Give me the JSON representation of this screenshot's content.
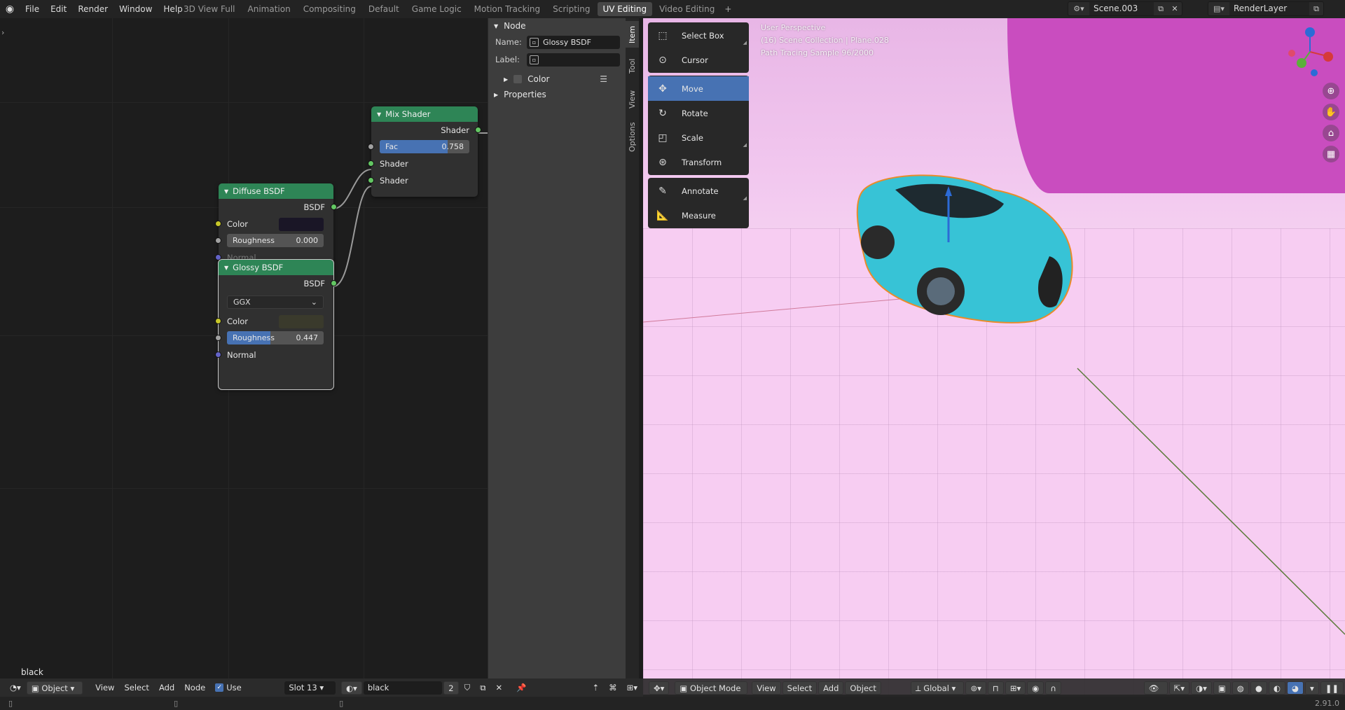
{
  "topbar": {
    "menus": [
      "File",
      "Edit",
      "Render",
      "Window",
      "Help"
    ],
    "workspaces": [
      "3D View Full",
      "Animation",
      "Compositing",
      "Default",
      "Game Logic",
      "Motion Tracking",
      "Scripting",
      "UV Editing",
      "Video Editing"
    ],
    "active_workspace": "UV Editing",
    "add_workspace": "+",
    "scene_name": "Scene.003",
    "view_layer": "RenderLayer"
  },
  "nodes": {
    "mix_shader": {
      "title": "Mix Shader",
      "output": "Shader",
      "fac_label": "Fac",
      "fac_value": "0.758",
      "fac_fraction": 0.758,
      "input1": "Shader",
      "input2": "Shader"
    },
    "diffuse": {
      "title": "Diffuse BSDF",
      "output": "BSDF",
      "color_label": "Color",
      "color_swatch": "#1a1626",
      "roughness_label": "Roughness",
      "roughness_value": "0.000",
      "normal_label": "Normal"
    },
    "glossy": {
      "title": "Glossy BSDF",
      "output": "BSDF",
      "distribution": "GGX",
      "color_label": "Color",
      "color_swatch": "#3a3a2c",
      "roughness_label": "Roughness",
      "roughness_value": "0.447",
      "roughness_fraction": 0.447,
      "normal_label": "Normal"
    }
  },
  "node_editor": {
    "material_label": "black"
  },
  "npanel": {
    "tabs": [
      "Item",
      "Tool",
      "View",
      "Options"
    ],
    "active_tab": "Item",
    "node_section": "Node",
    "name_label": "Name:",
    "name_value": "Glossy BSDF",
    "label_label": "Label:",
    "label_value": "",
    "color_section": "Color",
    "properties_section": "Properties"
  },
  "viewport": {
    "overlay_line1": "User Perspective",
    "overlay_line2": "(16) Scene Collection | Plane.028",
    "overlay_line3": "Path Tracing Sample 96/2000",
    "tools": [
      "Select Box",
      "Cursor",
      "Move",
      "Rotate",
      "Scale",
      "Transform"
    ],
    "active_tool": "Move",
    "annotate_tools": [
      "Annotate",
      "Measure"
    ],
    "colors": {
      "wall": "#c94dbf",
      "floor": "#f7cdf2",
      "car": "#37c3d6"
    }
  },
  "node_header": {
    "mode": "Object",
    "view": "View",
    "select": "Select",
    "add": "Add",
    "node": "Node",
    "use_nodes": "Use Nodes",
    "slot": "Slot 13",
    "material": "black",
    "users": "2"
  },
  "viewport_header": {
    "mode": "Object Mode",
    "view": "View",
    "select": "Select",
    "add": "Add",
    "object": "Object",
    "orientation": "Global"
  },
  "statusbar": {
    "version": "2.91.0"
  }
}
